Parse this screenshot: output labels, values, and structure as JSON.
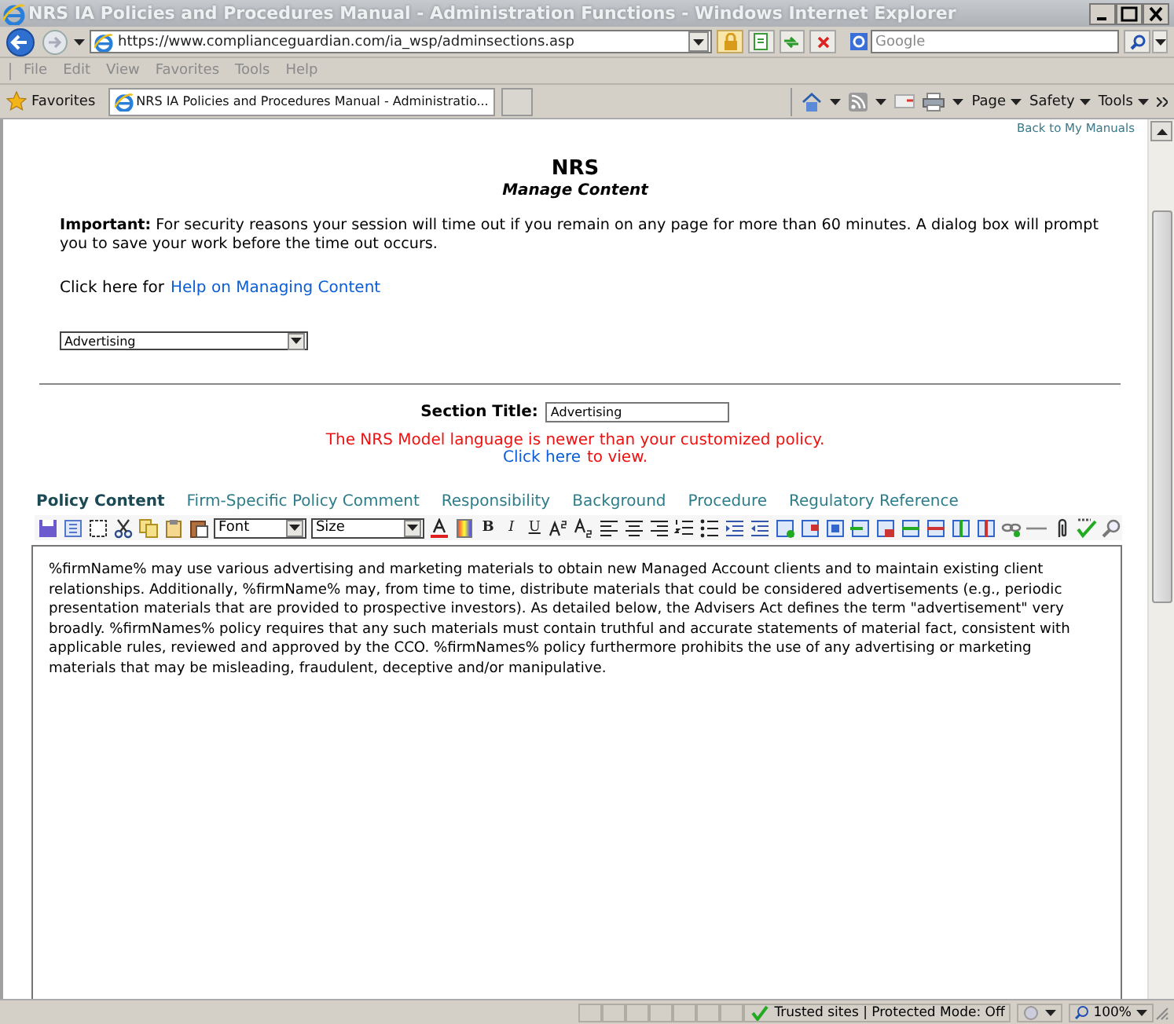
{
  "window": {
    "title": "NRS IA Policies and Procedures Manual - Administration Functions - Windows Internet Explorer"
  },
  "address_bar": {
    "url": "https://www.complianceguardian.com/ia_wsp/adminsections.asp",
    "search_placeholder": "Google"
  },
  "menu_bar": [
    "File",
    "Edit",
    "View",
    "Favorites",
    "Tools",
    "Help"
  ],
  "favorites_bar": {
    "favorites": "Favorites",
    "tabs": [
      {
        "label": "NRS IA Policies and Procedures Manual - Administratio...",
        "selected": true
      }
    ],
    "commands": [
      "Page",
      "Safety",
      "Tools"
    ]
  },
  "page": {
    "back_link": "Back to My Manuals",
    "heading": "NRS",
    "subheading": "Manage Content",
    "notice": "**Important:** For security reasons your session will time out if you remain on any page for more than 60 minutes. A dialog box will prompt you to save your work before the time out occurs.",
    "help_prefix": "Click here for",
    "help_link": "Help on Managing Content",
    "section_select": "Advertising",
    "section_title_label": "Section Title:",
    "section_title_value": "Advertising",
    "warning": "The NRS Model language is newer than your customized policy.",
    "view_link": "Click here",
    "view_suffix": "to view.",
    "tabs": [
      {
        "label": "Policy Content",
        "selected": true
      },
      {
        "label": "Firm-Specific Policy Comment",
        "selected": false
      },
      {
        "label": "Responsibility",
        "selected": false
      },
      {
        "label": "Background",
        "selected": false
      },
      {
        "label": "Procedure",
        "selected": false
      },
      {
        "label": "Regulatory Reference",
        "selected": false
      }
    ],
    "editor": {
      "font_select": "Font",
      "size_select": "Size",
      "format_buttons": [
        "B",
        "I",
        "U"
      ],
      "content": "%firmName% may use various advertising and marketing materials to obtain new Managed Account clients and to maintain existing client relationships. Additionally, %firmName% may, from time to time, distribute materials that could be considered advertisements (e.g., periodic presentation materials that are provided to prospective investors). As detailed below, the Advisers Act defines the term \"advertisement\" very broadly. %firmNames% policy requires that any such materials must contain truthful and accurate statements of material fact, consistent with applicable rules, reviewed and approved by the CCO. %firmNames% policy furthermore prohibits the use of any advertising or marketing materials that may be misleading, fraudulent, deceptive and/or manipulative."
    }
  },
  "status_bar": {
    "zone": "Trusted sites | Protected Mode: Off",
    "zoom": "100%"
  }
}
